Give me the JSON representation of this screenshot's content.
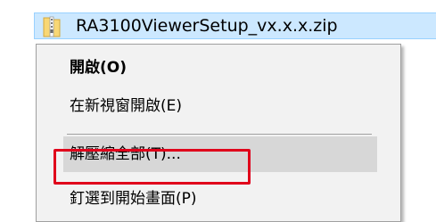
{
  "file": {
    "name": "RA3100ViewerSetup_vx.x.x.zip",
    "icon": "zip-folder-icon"
  },
  "menu": {
    "open_label": "開啟(O)",
    "open_new_window_label": "在新視窗開啟(E)",
    "extract_all_label": "解壓縮全部(T)...",
    "pin_to_start_label": "釘選到開始畫面(P)"
  },
  "colors": {
    "selection_bg": "#cce8ff",
    "menu_bg": "#f2f2f2",
    "hover_bg": "#d7d7d7",
    "callout_red": "#e0001b"
  }
}
